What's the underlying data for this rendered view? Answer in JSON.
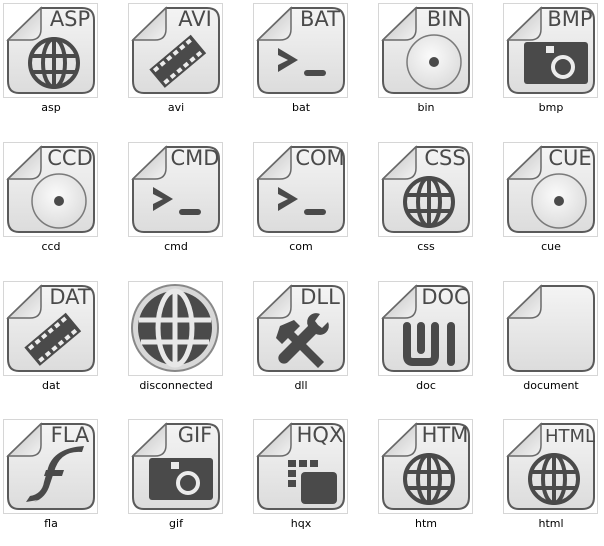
{
  "window": {
    "view": "file-type icon thumbnails"
  },
  "colors": {
    "page_background": "#ffffff",
    "thumb_border": "#d6d6d6",
    "glyph": "#4a4a4a",
    "paper": "#ececec"
  },
  "items": [
    {
      "label": "asp",
      "badge": "ASP",
      "glyph": "globe-icon"
    },
    {
      "label": "avi",
      "badge": "AVI",
      "glyph": "film-strip-icon"
    },
    {
      "label": "bat",
      "badge": "BAT",
      "glyph": "terminal-prompt-icon"
    },
    {
      "label": "bin",
      "badge": "BIN",
      "glyph": "disc-icon"
    },
    {
      "label": "bmp",
      "badge": "BMP",
      "glyph": "camera-icon"
    },
    {
      "label": "ccd",
      "badge": "CCD",
      "glyph": "disc-icon"
    },
    {
      "label": "cmd",
      "badge": "CMD",
      "glyph": "terminal-prompt-icon"
    },
    {
      "label": "com",
      "badge": "COM",
      "glyph": "terminal-prompt-icon"
    },
    {
      "label": "css",
      "badge": "CSS",
      "glyph": "globe-icon"
    },
    {
      "label": "cue",
      "badge": "CUE",
      "glyph": "disc-icon"
    },
    {
      "label": "dat",
      "badge": "DAT",
      "glyph": "film-strip-icon"
    },
    {
      "label": "disconnected",
      "badge": "",
      "glyph": "big-globe-icon"
    },
    {
      "label": "dll",
      "badge": "DLL",
      "glyph": "tools-icon"
    },
    {
      "label": "doc",
      "badge": "DOC",
      "glyph": "word-icon"
    },
    {
      "label": "document",
      "badge": "",
      "glyph": "blank-page-icon"
    },
    {
      "label": "fla",
      "badge": "FLA",
      "glyph": "flash-icon"
    },
    {
      "label": "gif",
      "badge": "GIF",
      "glyph": "camera-icon"
    },
    {
      "label": "hqx",
      "badge": "HQX",
      "glyph": "blocks-icon"
    },
    {
      "label": "htm",
      "badge": "HTM",
      "glyph": "globe-icon"
    },
    {
      "label": "html",
      "badge": "HTML",
      "glyph": "globe-icon"
    }
  ]
}
